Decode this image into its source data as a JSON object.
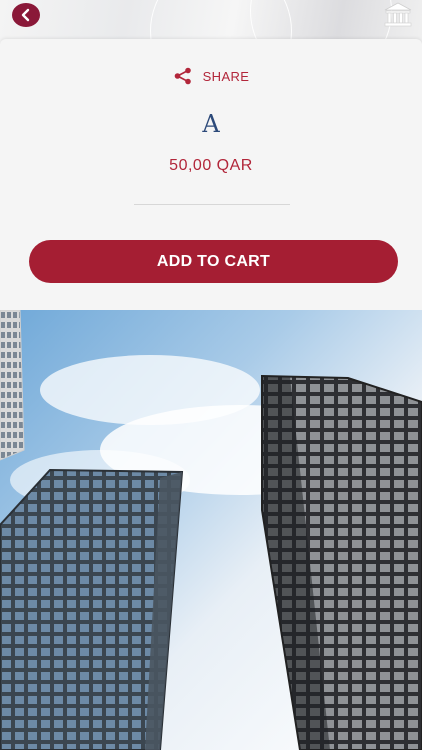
{
  "header": {
    "back_icon": "chevron-left-icon",
    "bank_icon": "bank-icon",
    "accent_color": "#8a1838"
  },
  "product": {
    "share_label": "SHARE",
    "share_icon": "share-icon",
    "title": "A",
    "price": "50,00 QAR"
  },
  "actions": {
    "add_to_cart_label": "ADD TO CART",
    "button_color": "#a51e33"
  },
  "image": {
    "subject": "skyscrapers-photo"
  }
}
